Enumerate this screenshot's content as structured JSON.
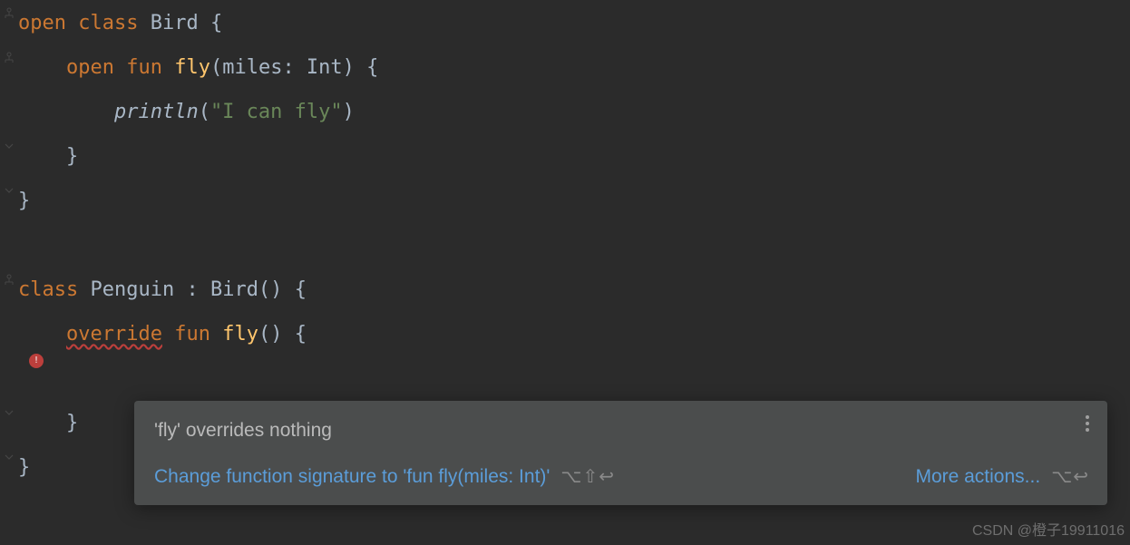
{
  "code": {
    "line1": {
      "kw_open": "open",
      "kw_class": "class",
      "cls": "Bird",
      "brace": "{"
    },
    "line2": {
      "kw_open": "open",
      "kw_fun": "fun",
      "fn": "fly",
      "params": "(miles: Int)",
      "brace": "{"
    },
    "line3": {
      "fn": "println",
      "paren_open": "(",
      "str": "\"I can fly\"",
      "paren_close": ")"
    },
    "line4": {
      "brace": "}"
    },
    "line5": {
      "brace": "}"
    },
    "line6": {
      "kw_class": "class",
      "cls": "Penguin",
      "colon": ":",
      "base": "Bird()",
      "brace": "{"
    },
    "line7": {
      "kw_override": "override",
      "kw_fun": "fun",
      "fn": "fly",
      "params": "()",
      "brace": "{"
    },
    "line9": {
      "brace": "}"
    },
    "line10": {
      "brace": "}"
    }
  },
  "tooltip": {
    "title": "'fly' overrides nothing",
    "fix": "Change function signature to 'fun fly(miles: Int)'",
    "fix_shortcut": "⌥⇧↩",
    "more": "More actions...",
    "more_shortcut": "⌥↩"
  },
  "watermark": "CSDN @橙子19911016"
}
